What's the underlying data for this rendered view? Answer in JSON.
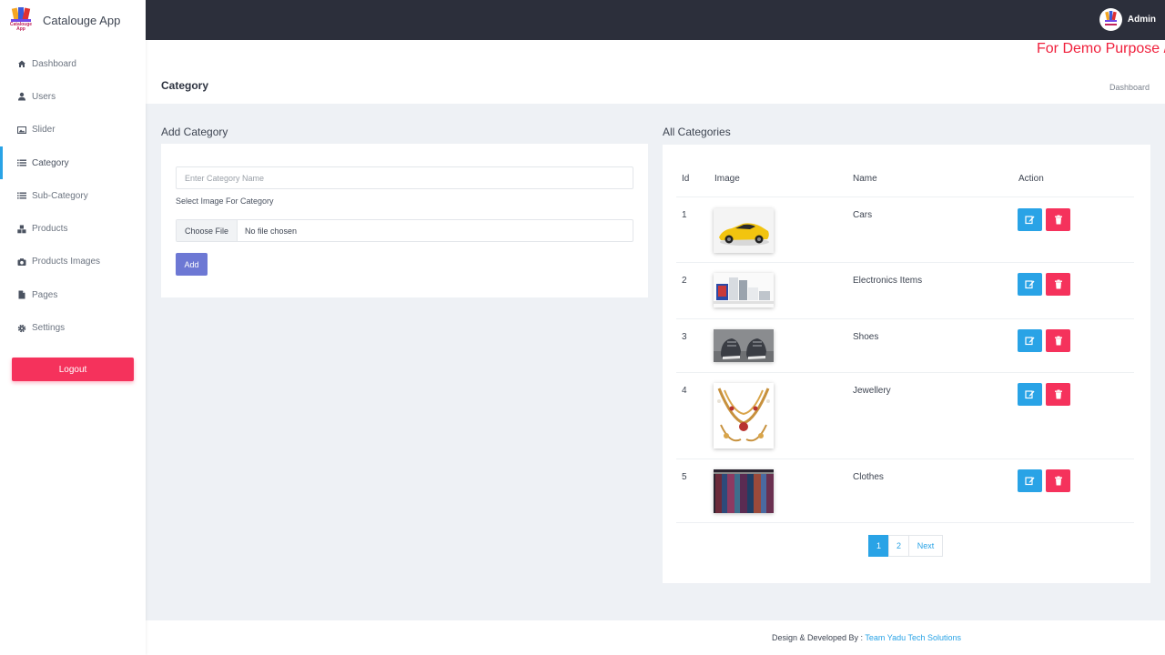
{
  "app": {
    "title": "Catalouge App",
    "logo_text": "Catalouge App",
    "colors": {
      "accent": "#29a3e6",
      "danger": "#f5325c",
      "primary": "#6d78d4",
      "topbar": "#2c2f3b"
    }
  },
  "sidebar": {
    "items": [
      {
        "label": "Dashboard",
        "icon": "home-icon"
      },
      {
        "label": "Users",
        "icon": "user-icon"
      },
      {
        "label": "Slider",
        "icon": "image-icon"
      },
      {
        "label": "Category",
        "icon": "list-icon",
        "active": true
      },
      {
        "label": "Sub-Category",
        "icon": "list-icon"
      },
      {
        "label": "Products",
        "icon": "cubes-icon"
      },
      {
        "label": "Products Images",
        "icon": "camera-icon"
      },
      {
        "label": "Pages",
        "icon": "file-icon"
      },
      {
        "label": "Settings",
        "icon": "gear-icon"
      }
    ],
    "logout_label": "Logout"
  },
  "topbar": {
    "user_name": "Admin"
  },
  "banner": "For Demo Purpose /",
  "page": {
    "title": "Category",
    "breadcrumb": "Dashboard"
  },
  "add_category": {
    "title": "Add Category",
    "name_placeholder": "Enter Category Name",
    "image_label": "Select Image For Category",
    "choose_file_label": "Choose File",
    "file_status": "No file chosen",
    "add_label": "Add"
  },
  "all_categories": {
    "title": "All Categories",
    "columns": [
      "Id",
      "Image",
      "Name",
      "Action"
    ],
    "rows": [
      {
        "id": "1",
        "name": "Cars",
        "image": "yellow-car"
      },
      {
        "id": "2",
        "name": "Electronics Items",
        "image": "electronics"
      },
      {
        "id": "3",
        "name": "Shoes",
        "image": "shoes"
      },
      {
        "id": "4",
        "name": "Jewellery",
        "image": "jewellery"
      },
      {
        "id": "5",
        "name": "Clothes",
        "image": "clothes-rack"
      }
    ],
    "pagination": {
      "pages": [
        "1",
        "2"
      ],
      "current": "1",
      "next_label": "Next"
    }
  },
  "footer": {
    "prefix": "Design & Developed By :",
    "link": "Team Yadu Tech Solutions"
  }
}
